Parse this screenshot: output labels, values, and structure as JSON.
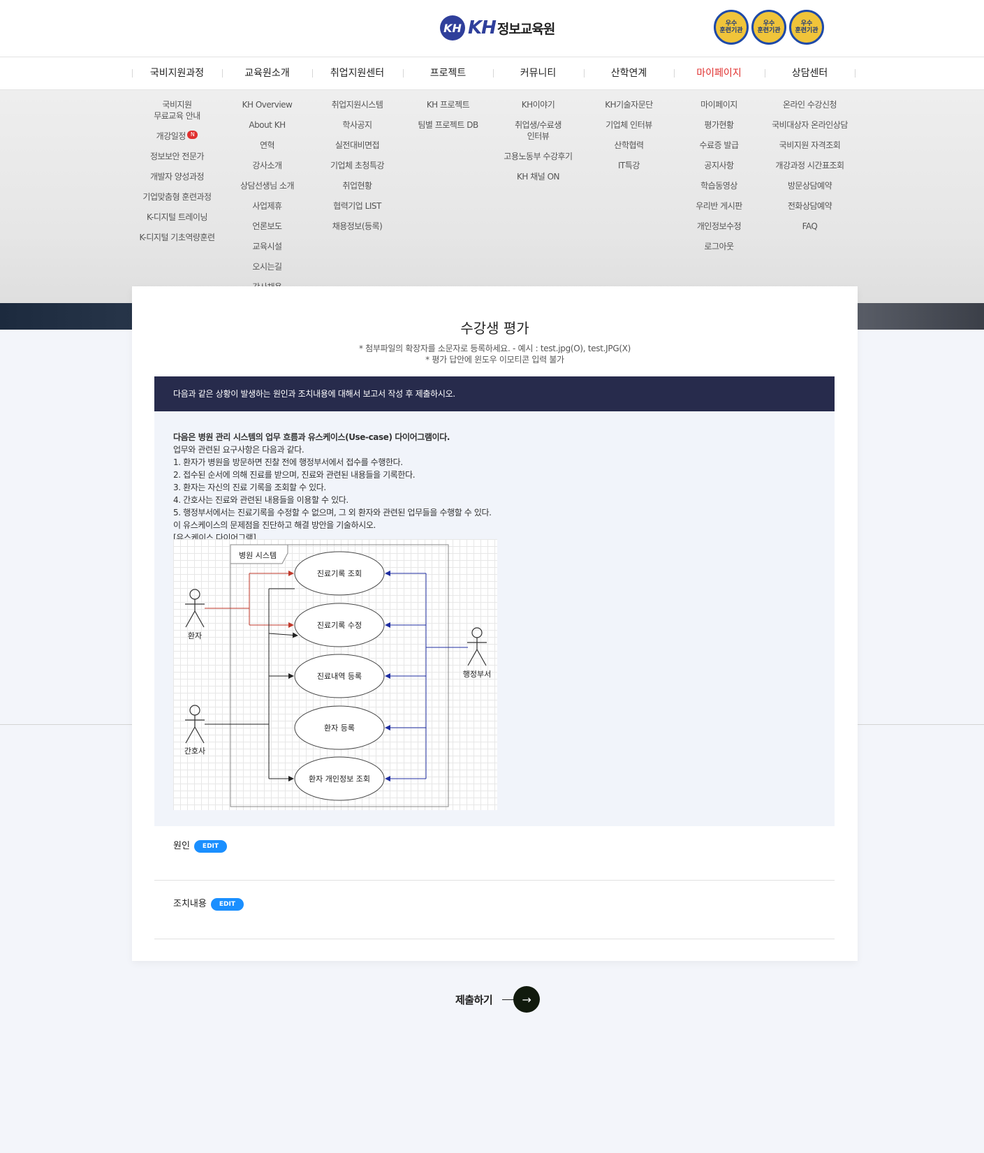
{
  "header": {
    "logo_mark": "KH",
    "logo_brand": "KH",
    "logo_name": "정보교육원",
    "badges": [
      "우수\n훈련기관",
      "우수\n훈련기관",
      "우수\n훈련기관"
    ]
  },
  "gnb": [
    {
      "label": "국비지원과정"
    },
    {
      "label": "교육원소개"
    },
    {
      "label": "취업지원센터"
    },
    {
      "label": "프로젝트"
    },
    {
      "label": "커뮤니티"
    },
    {
      "label": "산학연계"
    },
    {
      "label": "마이페이지",
      "active": true
    },
    {
      "label": "상담센터"
    }
  ],
  "megamenu": [
    [
      "국비지원\n무료교육 안내",
      "개강일정",
      "정보보안 전문가",
      "개발자 양성과정",
      "기업맞춤형 훈련과정",
      "K-디지털 트레이닝",
      "K-디지털 기초역량훈련"
    ],
    [
      "KH Overview",
      "About KH",
      "연혁",
      "강사소개",
      "상담선생님 소개",
      "사업제휴",
      "언론보도",
      "교육시설",
      "오시는길",
      "강사채용"
    ],
    [
      "취업지원시스템",
      "학사공지",
      "실전대비면접",
      "기업체 초청특강",
      "취업현황",
      "협력기업 LIST",
      "채용정보(등록)"
    ],
    [
      "KH 프로젝트",
      "팀별 프로젝트 DB"
    ],
    [
      "KH이야기",
      "취업생/수료생\n인터뷰",
      "고용노동부 수강후기",
      "KH 채널 ON"
    ],
    [
      "KH기술자문단",
      "기업체 인터뷰",
      "산학협력",
      "IT특강"
    ],
    [
      "마이페이지",
      "평가현황",
      "수료증 발급",
      "공지사항",
      "학습동영상",
      "우리반 게시판",
      "개인정보수정",
      "로그아웃"
    ],
    [
      "온라인 수강신청",
      "국비대상자 온라인상담",
      "국비지원 자격조회",
      "개강과정 시간표조회",
      "방문상담예약",
      "전화상담예약",
      "FAQ"
    ]
  ],
  "new_badge": "N",
  "page": {
    "title": "수강생 평가",
    "notice1": "* 첨부파일의 확장자를 소문자로 등록하세요. - 예시 : test.jpg(O), test.JPG(X)",
    "notice2": "* 평가 답안에 윈도우 이모티콘 입력 불가"
  },
  "question": {
    "bar": "다음과 같은 상황이 발생하는 원인과 조치내용에 대해서 보고서 작성 후 제출하시오.",
    "lines": [
      "다음은 병원 관리 시스템의 업무 흐름과 유스케이스(Use-case) 다이어그램이다.",
      "업무와 관련된 요구사항은 다음과 같다.",
      "1. 환자가 병원을 방문하면 진찰 전에 행정부서에서 접수를 수행한다.",
      "2. 접수된 순서에 의해 진료를 받으며, 진료와 관련된 내용들을 기록한다.",
      "3. 환자는 자신의 진료 기록을 조회할 수 있다.",
      "4. 간호사는 진료와 관련된 내용들을 이용할 수 있다.",
      "5. 행정부서에서는 진료기록을 수정할 수 없으며, 그 외 환자와 관련된 업무들을 수행할 수 있다.",
      "이 유스케이스의 문제점을 진단하고 해결 방안을 기술하시오.",
      "[유스케이스 다이어그램]"
    ]
  },
  "diagram": {
    "system_label": "병원 시스템",
    "usecases": [
      "진료기록 조회",
      "진료기록 수정",
      "진료내역 등록",
      "환자 등록",
      "환자 개인정보 조회"
    ],
    "actors": [
      "환자",
      "간호사",
      "행정부서"
    ],
    "colors": {
      "patient_arrow": "#c0392b",
      "admin_arrow": "#1f2ea0",
      "nurse_arrow": "#222222"
    }
  },
  "answers": {
    "cause_label": "원인",
    "action_label": "조치내용",
    "edit_label": "EDIT"
  },
  "submit": {
    "label": "제출하기",
    "arrow": "→"
  },
  "colors": {
    "accent_red": "#e0302f",
    "question_bar": "#272b4c",
    "edit_blue": "#1a8fff",
    "submit_circle": "#111a0d"
  }
}
